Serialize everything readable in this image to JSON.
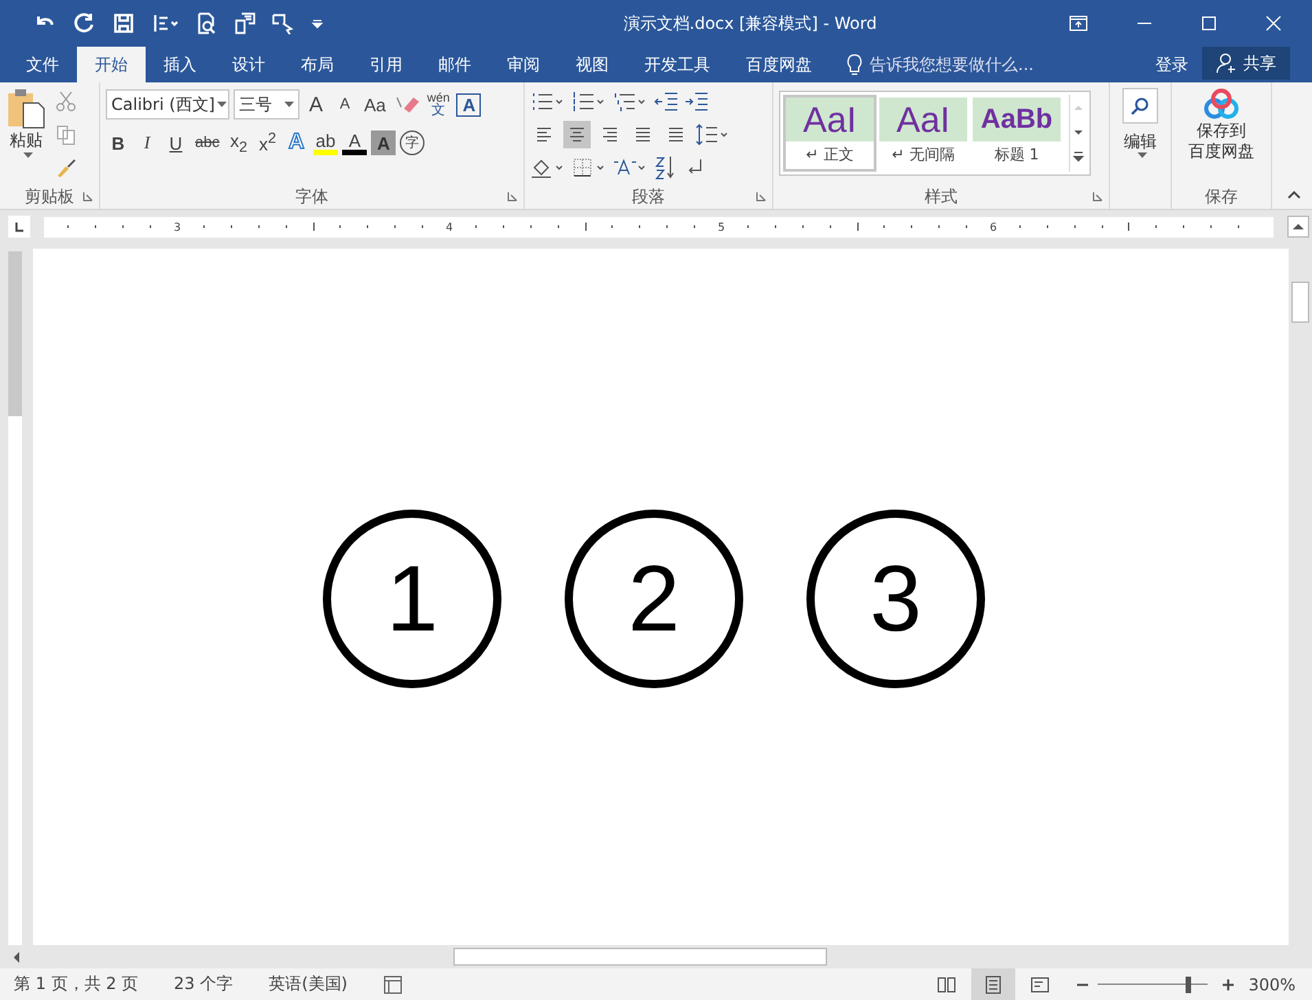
{
  "window": {
    "title": "演示文档.docx [兼容模式] - Word"
  },
  "tabs": [
    {
      "label": "文件",
      "selected": false
    },
    {
      "label": "开始",
      "selected": true
    },
    {
      "label": "插入",
      "selected": false
    },
    {
      "label": "设计",
      "selected": false
    },
    {
      "label": "布局",
      "selected": false
    },
    {
      "label": "引用",
      "selected": false
    },
    {
      "label": "邮件",
      "selected": false
    },
    {
      "label": "审阅",
      "selected": false
    },
    {
      "label": "视图",
      "selected": false
    },
    {
      "label": "开发工具",
      "selected": false
    },
    {
      "label": "百度网盘",
      "selected": false
    }
  ],
  "tell_me": {
    "placeholder": "告诉我您想要做什么..."
  },
  "sign_in": "登录",
  "share": "共享",
  "clipboard": {
    "label": "剪贴板",
    "paste": "粘贴"
  },
  "font": {
    "label": "字体",
    "font_name": "Calibri (西文]",
    "font_size": "三号",
    "row1": [
      {
        "kind": "grow",
        "label": "A"
      },
      {
        "kind": "shrink",
        "label": "A"
      },
      {
        "kind": "case",
        "label": "Aa"
      },
      {
        "kind": "clear"
      },
      {
        "kind": "phonetic",
        "label": "wén",
        "sub": "文"
      },
      {
        "kind": "border",
        "label": "A"
      }
    ],
    "row2": [
      {
        "kind": "bold",
        "label": "B"
      },
      {
        "kind": "italic",
        "label": "I"
      },
      {
        "kind": "underline",
        "label": "U"
      },
      {
        "kind": "strike",
        "label": "abc"
      },
      {
        "kind": "script",
        "label": "x$_{2}$"
      },
      {
        "kind": "script",
        "label": "x$^{2}$"
      },
      {
        "kind": "effect",
        "label": "A"
      },
      {
        "kind": "highlight",
        "label": "ab"
      },
      {
        "kind": "color",
        "label": "A"
      },
      {
        "kind": "shade",
        "label": "A"
      },
      {
        "kind": "enclose",
        "label": "字"
      }
    ]
  },
  "paragraph": {
    "label": "段落",
    "align": [
      {
        "kind": "left",
        "selected": false
      },
      {
        "kind": "center",
        "selected": true
      },
      {
        "kind": "right",
        "selected": false
      },
      {
        "kind": "justify",
        "selected": false
      },
      {
        "kind": "distribute",
        "selected": false
      }
    ]
  },
  "styles": {
    "label": "样式",
    "items": [
      {
        "preview": "AaI",
        "name": "↵ 正文",
        "selected": true
      },
      {
        "preview": "AaI",
        "name": "↵ 无间隔",
        "selected": false
      },
      {
        "preview": "AaBb",
        "name": "标题 1",
        "selected": false
      }
    ]
  },
  "editing": {
    "label": "编辑"
  },
  "save": {
    "button": "保存到",
    "button_line2": "百度网盘",
    "label": "保存"
  },
  "ruler": [
    "3",
    "4",
    "5",
    "6"
  ],
  "document": {
    "circled_numbers": [
      "1",
      "2",
      "3"
    ]
  },
  "status_bar": {
    "items": [
      "第 1 页，共 2 页",
      "23 个字",
      "英语(美国)"
    ],
    "views": [
      {
        "kind": "read",
        "selected": false
      },
      {
        "kind": "print",
        "selected": true
      },
      {
        "kind": "web",
        "selected": false
      }
    ],
    "zoom": {
      "level": 0.8,
      "text": "300%"
    }
  }
}
